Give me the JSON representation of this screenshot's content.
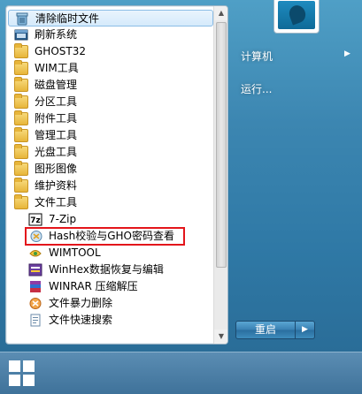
{
  "programs": [
    {
      "label": "清除临时文件",
      "icon": "recycle-icon",
      "selected": true,
      "sub": false
    },
    {
      "label": "刷新系统",
      "icon": "window-icon",
      "sub": false
    },
    {
      "label": "GHOST32",
      "icon": "folder-icon",
      "sub": false
    },
    {
      "label": "WIM工具",
      "icon": "folder-icon",
      "sub": false
    },
    {
      "label": "磁盘管理",
      "icon": "folder-icon",
      "sub": false
    },
    {
      "label": "分区工具",
      "icon": "folder-icon",
      "sub": false
    },
    {
      "label": "附件工具",
      "icon": "folder-icon",
      "sub": false
    },
    {
      "label": "管理工具",
      "icon": "folder-icon",
      "sub": false
    },
    {
      "label": "光盘工具",
      "icon": "folder-icon",
      "sub": false
    },
    {
      "label": "图形图像",
      "icon": "folder-icon",
      "sub": false
    },
    {
      "label": "维护资料",
      "icon": "folder-icon",
      "sub": false
    },
    {
      "label": "文件工具",
      "icon": "folder-icon",
      "sub": false
    },
    {
      "label": "7-Zip",
      "icon": "7zip-icon",
      "sub": true
    },
    {
      "label": "Hash校验与GHO密码查看",
      "icon": "hash-icon",
      "sub": true,
      "highlighted": true
    },
    {
      "label": "WIMTOOL",
      "icon": "wimtool-icon",
      "sub": true
    },
    {
      "label": "WinHex数据恢复与编辑",
      "icon": "winhex-icon",
      "sub": true
    },
    {
      "label": "WINRAR 压缩解压",
      "icon": "winrar-icon",
      "sub": true
    },
    {
      "label": "文件暴力删除",
      "icon": "delete-icon",
      "sub": true
    },
    {
      "label": "文件快速搜索",
      "icon": "search-file-icon",
      "sub": true
    }
  ],
  "right": {
    "computer": "计算机",
    "run": "运行..."
  },
  "shutdown": {
    "label": "重启"
  },
  "colors": {
    "highlight_border": "#e3151b",
    "selected_bg": "#d5eafb"
  }
}
